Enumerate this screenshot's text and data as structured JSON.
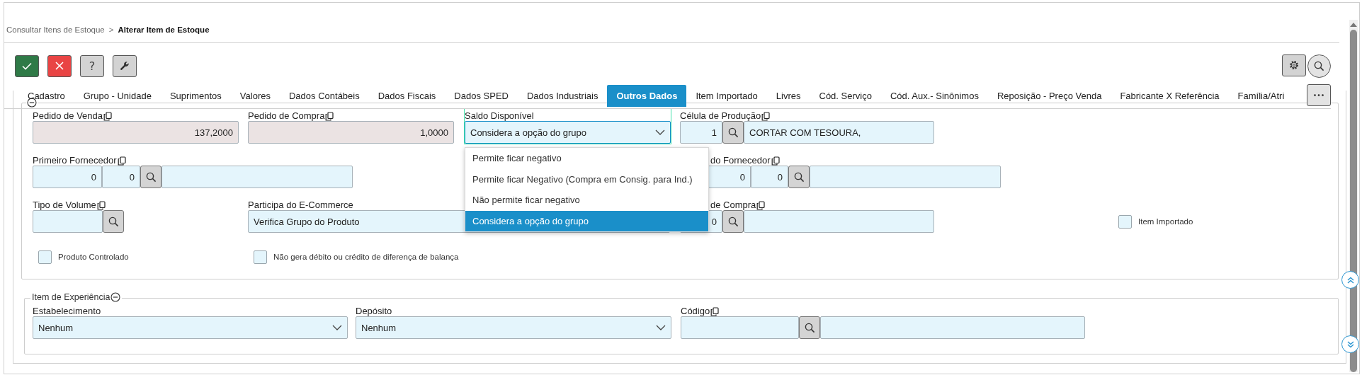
{
  "breadcrumb": [
    {
      "label": "Consultar Itens de Estoque",
      "current": false
    },
    {
      "label": "Alterar Item de Estoque",
      "current": true
    }
  ],
  "breadcrumb_separator": ">",
  "toolbar": [
    {
      "kind": "confirm"
    },
    {
      "kind": "cancel"
    },
    {
      "kind": "help",
      "label": "?"
    },
    {
      "kind": "tools"
    }
  ],
  "toolbar_right": [
    {
      "kind": "settings"
    },
    {
      "kind": "search"
    }
  ],
  "tabs": [
    {
      "label": "Cadastro",
      "selected": false
    },
    {
      "label": "Grupo - Unidade",
      "selected": false
    },
    {
      "label": "Suprimentos",
      "selected": false
    },
    {
      "label": "Valores",
      "selected": false
    },
    {
      "label": "Dados Contábeis",
      "selected": false
    },
    {
      "label": "Dados Fiscais",
      "selected": false
    },
    {
      "label": "Dados SPED",
      "selected": false
    },
    {
      "label": "Dados Industriais",
      "selected": false
    },
    {
      "label": "Outros Dados",
      "selected": true
    },
    {
      "label": "Item Importado",
      "selected": false
    },
    {
      "label": "Livres",
      "selected": false
    },
    {
      "label": "Cód. Serviço",
      "selected": false
    },
    {
      "label": "Cód. Aux.- Sinônimos",
      "selected": false
    },
    {
      "label": "Reposição - Preço Venda",
      "selected": false
    },
    {
      "label": "Fabricante X Referência",
      "selected": false
    },
    {
      "label": "Família/Atri",
      "selected": false
    }
  ],
  "main_panel": {
    "expanded": true,
    "fields": [
      {
        "kind": "number",
        "label": "Pedido de Venda",
        "copyable": true,
        "disabled": true,
        "focused": false,
        "value": "137,2000"
      },
      {
        "kind": "number",
        "label": "Pedido de Compra",
        "copyable": true,
        "disabled": true,
        "focused": false,
        "value": "1,0000"
      },
      {
        "kind": "select",
        "label": "Saldo Disponível",
        "copyable": false,
        "disabled": false,
        "focused": true,
        "value": "Considera a opção do grupo",
        "open": true,
        "options": [
          {
            "label": "Permite ficar negativo",
            "selected": false
          },
          {
            "label": "Permite ficar Negativo (Compra em Consig. para Ind.)",
            "selected": false
          },
          {
            "label": "Não permite ficar negativo",
            "selected": false
          },
          {
            "label": "Considera a opção do grupo",
            "selected": true
          }
        ]
      },
      {
        "kind": "lookup",
        "label": "Célula de Produção",
        "copyable": true,
        "disabled": false,
        "focused": false,
        "codes": [
          "1"
        ],
        "description": "CORTAR COM TESOURA,"
      },
      {
        "kind": "lookup",
        "label": "Primeiro Fornecedor",
        "copyable": true,
        "disabled": false,
        "focused": false,
        "codes": [
          "0",
          "0"
        ]
      },
      {
        "kind": "lookup",
        "label": "do Fornecedor",
        "copyable": true,
        "disabled": false,
        "focused": false,
        "codes": [
          "0",
          "0"
        ]
      },
      {
        "kind": "code-search",
        "label": "Tipo de Volume",
        "copyable": true,
        "disabled": false,
        "focused": false
      },
      {
        "kind": "text",
        "label": "Participa do E-Commerce",
        "copyable": false,
        "disabled": false,
        "focused": false,
        "value": "Verifica Grupo do Produto"
      },
      {
        "kind": "lookup",
        "label": "de Compra",
        "copyable": true,
        "disabled": false,
        "focused": false,
        "codes": [
          "0"
        ]
      },
      {
        "kind": "checkbox",
        "label": "Item Importado",
        "checked": false
      },
      {
        "kind": "checkbox",
        "label": "Produto Controlado",
        "checked": false
      },
      {
        "kind": "checkbox",
        "label": "Não gera débito ou crédito de diferença de balança",
        "checked": false
      }
    ]
  },
  "experience_section": {
    "title": "Item de Experiência",
    "expanded": true,
    "fields": [
      {
        "kind": "select",
        "label": "Estabelecimento",
        "copyable": false,
        "disabled": false,
        "focused": false,
        "value": "Nenhum",
        "open": false
      },
      {
        "kind": "select",
        "label": "Depósito",
        "copyable": false,
        "disabled": false,
        "focused": false,
        "value": "Nenhum",
        "open": false
      },
      {
        "kind": "lookup",
        "label": "Código",
        "copyable": true,
        "disabled": false,
        "focused": false
      }
    ]
  }
}
